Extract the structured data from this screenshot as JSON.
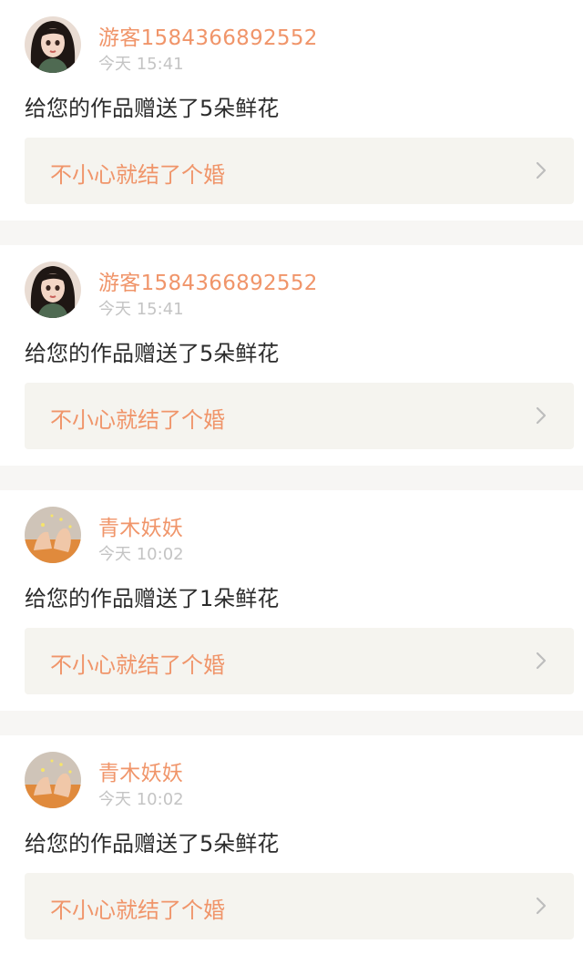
{
  "notifications": [
    {
      "user": "游客1584366892552",
      "time": "今天 15:41",
      "message": "给您的作品赠送了5朵鲜花",
      "work_title": "不小心就结了个婚",
      "avatar_style": "girl-portrait"
    },
    {
      "user": "游客1584366892552",
      "time": "今天 15:41",
      "message": "给您的作品赠送了5朵鲜花",
      "work_title": "不小心就结了个婚",
      "avatar_style": "girl-portrait"
    },
    {
      "user": "青木妖妖",
      "time": "今天 10:02",
      "message": "给您的作品赠送了1朵鲜花",
      "work_title": "不小心就结了个婚",
      "avatar_style": "hands-photo"
    },
    {
      "user": "青木妖妖",
      "time": "今天 10:02",
      "message": "给您的作品赠送了5朵鲜花",
      "work_title": "不小心就结了个婚",
      "avatar_style": "hands-photo"
    }
  ],
  "colors": {
    "accent": "#f0956a",
    "card_bg": "#f5f4ef",
    "separator": "#f7f6f4",
    "timestamp": "#c4c4c4",
    "text": "#2c2c2c"
  },
  "icons": {
    "chevron": "chevron-right-icon"
  }
}
